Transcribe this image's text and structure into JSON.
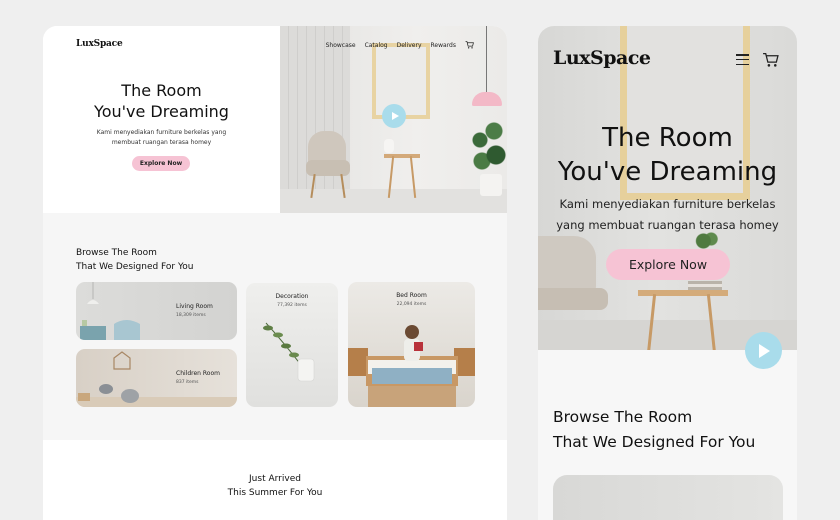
{
  "desktop": {
    "logo": {
      "prefix": "Lux",
      "s": "S",
      "suffix": "pace"
    },
    "nav": [
      {
        "label": "Showcase"
      },
      {
        "label": "Catalog"
      },
      {
        "label": "Delivery"
      },
      {
        "label": "Rewards"
      }
    ],
    "hero": {
      "title_line1": "The Room",
      "title_line2": "You've Dreaming",
      "subtitle_line1": "Kami menyediakan furniture berkelas yang",
      "subtitle_line2": "membuat ruangan terasa homey",
      "cta": "Explore Now"
    },
    "browse": {
      "title_line1": "Browse The Room",
      "title_line2": "That We Designed For You",
      "cards": [
        {
          "name": "Living Room",
          "count": "18,309 items"
        },
        {
          "name": "Children Room",
          "count": "837 items"
        },
        {
          "name": "Decoration",
          "count": "77,392 items"
        },
        {
          "name": "Bed Room",
          "count": "22,094 items"
        }
      ]
    },
    "arrived": {
      "title_line1": "Just Arrived",
      "title_line2": "This Summer For You"
    }
  },
  "mobile": {
    "logo": {
      "prefix": "Lux",
      "s": "S",
      "suffix": "pace"
    },
    "hero": {
      "title_line1": "The Room",
      "title_line2": "You've Dreaming",
      "subtitle_line1": "Kami menyediakan furniture berkelas",
      "subtitle_line2": "yang membuat ruangan terasa homey",
      "cta": "Explore Now"
    },
    "browse": {
      "title_line1": "Browse The Room",
      "title_line2": "That We Designed For You"
    }
  },
  "colors": {
    "accent_pink": "#f6c3d4",
    "play_blue": "#a9dceb",
    "frame_gold": "#e8d3a2"
  }
}
